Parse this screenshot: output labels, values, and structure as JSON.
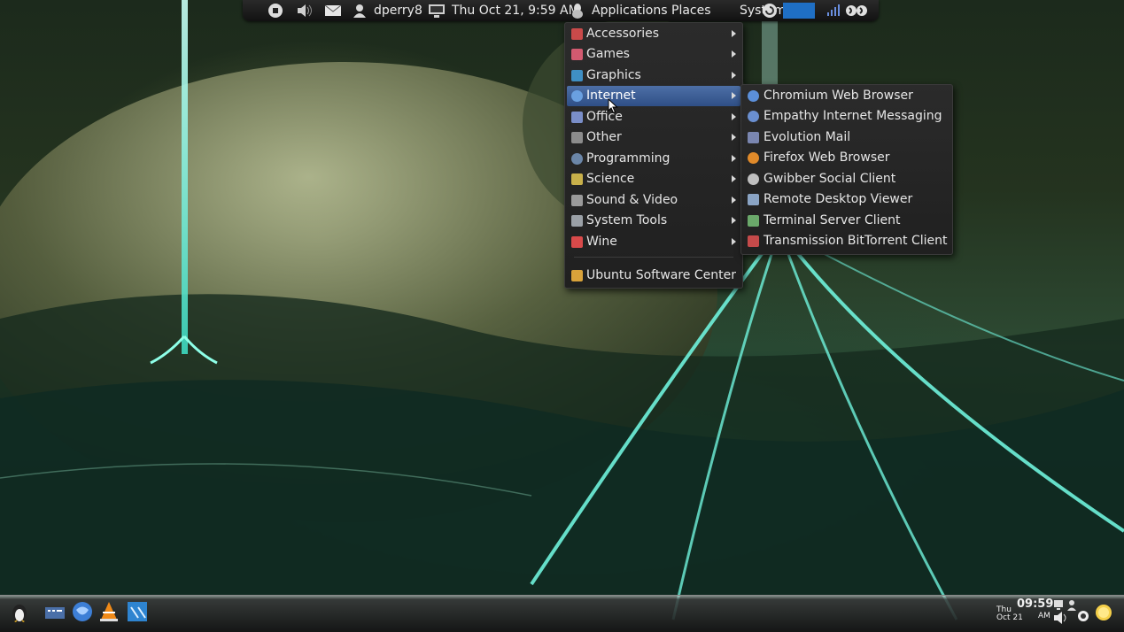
{
  "top_panel": {
    "user": "dperry8",
    "datetime": "Thu Oct 21,  9:59 AM",
    "menus": {
      "applications": "Applications",
      "places": "Places",
      "system": "System"
    },
    "icons": [
      "power-icon",
      "volume-icon",
      "mail-icon",
      "user-icon",
      "monitor-icon",
      "applications-icon",
      "update-icon",
      "network-signal-icon",
      "indicator-icon"
    ]
  },
  "applications_menu": {
    "items": [
      {
        "label": "Accessories",
        "icon": "accessories-icon",
        "color": "#c94a4a",
        "submenu": true
      },
      {
        "label": "Games",
        "icon": "games-icon",
        "color": "#d25a70",
        "submenu": true
      },
      {
        "label": "Graphics",
        "icon": "graphics-icon",
        "color": "#3f8fc4",
        "submenu": true
      },
      {
        "label": "Internet",
        "icon": "internet-icon",
        "color": "#6aa0e0",
        "submenu": true,
        "active": true
      },
      {
        "label": "Office",
        "icon": "office-icon",
        "color": "#7a8ec8",
        "submenu": true
      },
      {
        "label": "Other",
        "icon": "other-icon",
        "color": "#8c8c8c",
        "submenu": true
      },
      {
        "label": "Programming",
        "icon": "programming-icon",
        "color": "#6b86a8",
        "submenu": true
      },
      {
        "label": "Science",
        "icon": "science-icon",
        "color": "#c8b04a",
        "submenu": true
      },
      {
        "label": "Sound & Video",
        "icon": "sound-video-icon",
        "color": "#9a9a9a",
        "submenu": true
      },
      {
        "label": "System Tools",
        "icon": "system-tools-icon",
        "color": "#9aa0a6",
        "submenu": true
      },
      {
        "label": "Wine",
        "icon": "wine-icon",
        "color": "#d84a4a",
        "submenu": true
      }
    ],
    "footer_item": {
      "label": "Ubuntu Software Center",
      "icon": "software-center-icon",
      "color": "#d9a23a"
    }
  },
  "internet_submenu": {
    "items": [
      {
        "label": "Chromium Web Browser",
        "icon": "chromium-icon",
        "color": "#5b8fd9"
      },
      {
        "label": "Empathy Internet Messaging",
        "icon": "empathy-icon",
        "color": "#6a8fd0"
      },
      {
        "label": "Evolution Mail",
        "icon": "evolution-icon",
        "color": "#7a86b0"
      },
      {
        "label": "Firefox Web Browser",
        "icon": "firefox-icon",
        "color": "#e08a2a"
      },
      {
        "label": "Gwibber Social Client",
        "icon": "gwibber-icon",
        "color": "#bfbfbf"
      },
      {
        "label": "Remote Desktop Viewer",
        "icon": "remote-desktop-icon",
        "color": "#8aa4c4"
      },
      {
        "label": "Terminal Server Client",
        "icon": "terminal-server-icon",
        "color": "#6aa86a"
      },
      {
        "label": "Transmission BitTorrent Client",
        "icon": "transmission-icon",
        "color": "#c44a4a"
      }
    ]
  },
  "dock": {
    "items": [
      {
        "name": "tux-launcher-icon"
      },
      {
        "name": "file-manager-icon"
      },
      {
        "name": "browser-icon"
      },
      {
        "name": "vlc-icon"
      },
      {
        "name": "terminal-app-icon"
      }
    ],
    "clock": {
      "time": "09:59",
      "day": "Thu",
      "date": "Oct 21",
      "ampm": "AM"
    },
    "tray_icons": [
      "network-icon",
      "speaker-icon",
      "gear-tray-icon",
      "sun-icon"
    ]
  }
}
